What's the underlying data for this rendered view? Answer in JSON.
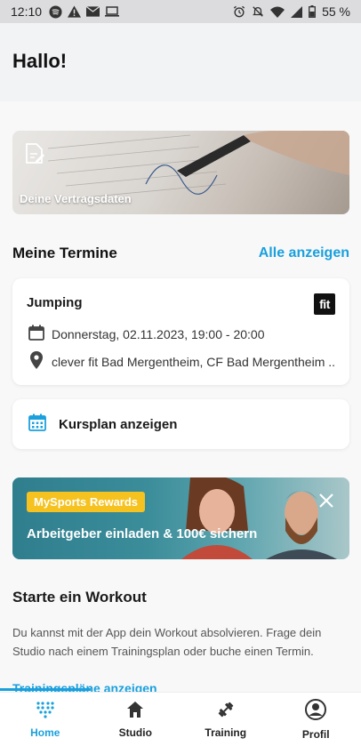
{
  "status_bar": {
    "time": "12:10",
    "battery": "55 %"
  },
  "greeting": "Hallo!",
  "contract_card": {
    "label": "Deine Vertragsdaten"
  },
  "appointments": {
    "title": "Meine Termine",
    "show_all": "Alle anzeigen",
    "item": {
      "title": "Jumping",
      "studio_logo": "fit",
      "date": "Donnerstag, 02.11.2023, 19:00 - 20:00",
      "location": "clever fit Bad Mergentheim, CF Bad Mergentheim ..."
    }
  },
  "course_plan": {
    "label": "Kursplan anzeigen"
  },
  "promo": {
    "badge": "MySports Rewards",
    "text": "Arbeitgeber einladen & 100€ sichern"
  },
  "workout": {
    "title": "Starte ein Workout",
    "description": "Du kannst mit der App dein Workout absolvieren. Frage dein Studio nach einem Trainingsplan oder buche einen Termin.",
    "link": "Trainingspläne anzeigen"
  },
  "tabs": [
    {
      "label": "Home",
      "icon": "dots-grid-icon",
      "active": true
    },
    {
      "label": "Studio",
      "icon": "house-icon",
      "active": false
    },
    {
      "label": "Training",
      "icon": "dumbbell-icon",
      "active": false
    },
    {
      "label": "Profil",
      "icon": "person-icon",
      "active": false
    }
  ],
  "colors": {
    "accent": "#1aa0dc",
    "badge": "#f5c21f"
  }
}
